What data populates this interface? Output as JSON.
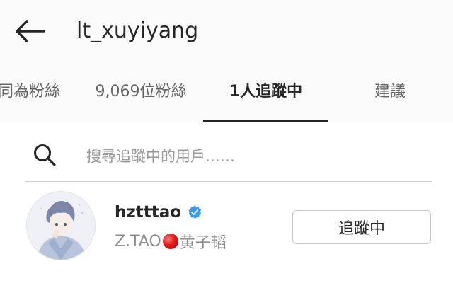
{
  "header": {
    "title": "lt_xuyiyang",
    "back_icon": "arrow-left-icon"
  },
  "tabs": [
    {
      "label": "共同為粉絲",
      "active": false
    },
    {
      "label": "9,069位粉絲",
      "active": false
    },
    {
      "label": "1人追蹤中",
      "active": true
    },
    {
      "label": "建議",
      "active": false
    }
  ],
  "search": {
    "placeholder": "搜尋追蹤中的用戶……",
    "value": "",
    "icon": "search-icon"
  },
  "following": [
    {
      "username": "hztttao",
      "verified": true,
      "fullname_prefix": "Z.TAO",
      "fullname_emoji": "red-circle",
      "fullname_suffix": "黄子韬",
      "button_label": "追蹤中"
    }
  ],
  "colors": {
    "verified_blue": "#3897f0",
    "active_text": "#262626",
    "inactive_text": "#666666",
    "header_bg": "#fafafa"
  }
}
